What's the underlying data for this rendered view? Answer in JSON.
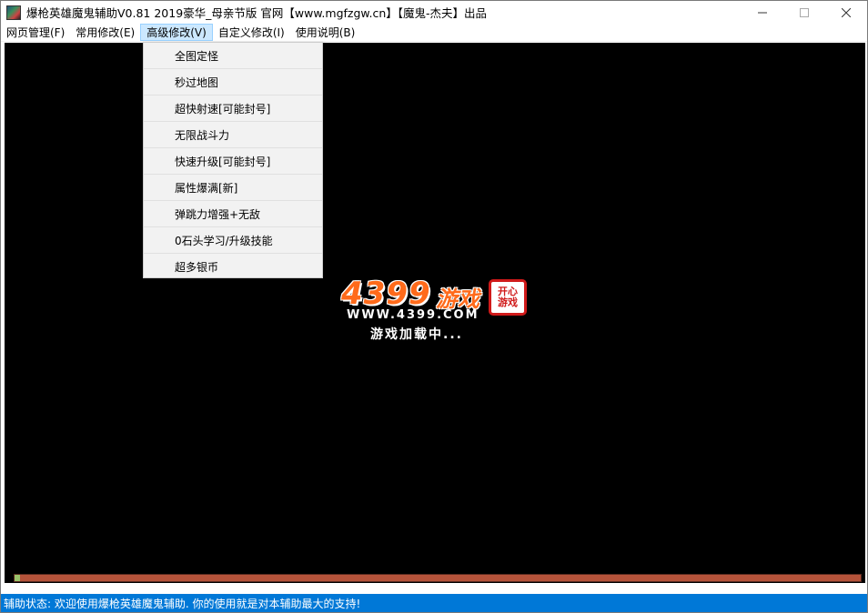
{
  "window": {
    "title": "爆枪英雄魔鬼辅助V0.81 2019豪华_母亲节版    官网【www.mgfzgw.cn】【魔鬼-杰夫】出品"
  },
  "menubar": {
    "items": [
      {
        "label": "网页管理(F)"
      },
      {
        "label": "常用修改(E)"
      },
      {
        "label": "高级修改(V)"
      },
      {
        "label": "自定义修改(I)"
      },
      {
        "label": "使用说明(B)"
      }
    ],
    "active_index": 2
  },
  "dropdown": {
    "items": [
      {
        "label": "全图定怪"
      },
      {
        "label": "秒过地图"
      },
      {
        "label": "超快射速[可能封号]"
      },
      {
        "label": "无限战斗力"
      },
      {
        "label": "快速升级[可能封号]"
      },
      {
        "label": "属性爆满[新]"
      },
      {
        "label": "弹跳力增强+无敌"
      },
      {
        "label": "0石头学习/升级技能"
      },
      {
        "label": "超多银币"
      }
    ]
  },
  "game": {
    "logo_number": "4399",
    "logo_word": "游戏",
    "logo_url": "WWW.4399.COM",
    "seal_text": "开心\n游戏",
    "loading_text": "游戏加载中...",
    "progress_fraction": 0.006
  },
  "statusbar": {
    "text": "辅助状态: 欢迎使用爆枪英雄魔鬼辅助. 你的使用就是对本辅助最大的支持!"
  },
  "colors": {
    "status_bg": "#0078d7",
    "menu_active_bg": "#cce8ff",
    "logo_orange": "#ff6a1a",
    "seal_red": "#d01a1a",
    "progress_track": "#b5533a",
    "progress_fill": "#9ac26a"
  },
  "icons": {
    "app": "app-icon",
    "minimize": "minimize-icon",
    "maximize": "maximize-icon",
    "close": "close-icon"
  }
}
